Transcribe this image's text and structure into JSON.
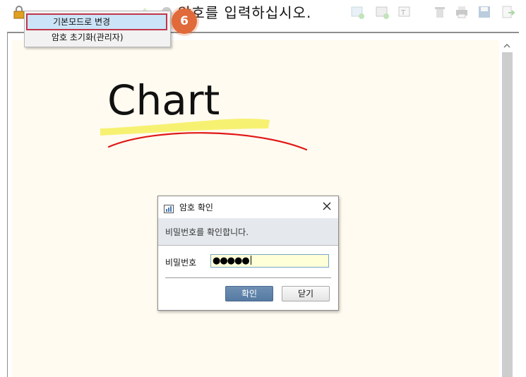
{
  "toolbar": {
    "prompt_text": "암호를 입력하십시오.",
    "icons": [
      "lock-icon",
      "pen-icon",
      "marker-icon",
      "pencil-icon",
      "highlighter-icon",
      "eraser-icon",
      "image-add-icon",
      "picture-icon",
      "screen-capture-icon",
      "text-icon",
      "trash-icon",
      "print-icon",
      "save-icon",
      "export-icon"
    ]
  },
  "context_menu": {
    "items": [
      {
        "label": "기본모드로 변경",
        "selected": true
      },
      {
        "label": "암호 초기화(관리자)",
        "selected": false
      }
    ]
  },
  "step_badge": "6",
  "canvas": {
    "handwriting": "Chart",
    "background_color": "#fffbf0",
    "highlight_color": "#f7f06a",
    "underline_color": "#e01818"
  },
  "dialog": {
    "title": "암호 확인",
    "message": "비밀번호를 확인합니다.",
    "password_label": "비밀번호",
    "password_value": "●●●●●",
    "ok_label": "확인",
    "close_label": "닫기"
  }
}
